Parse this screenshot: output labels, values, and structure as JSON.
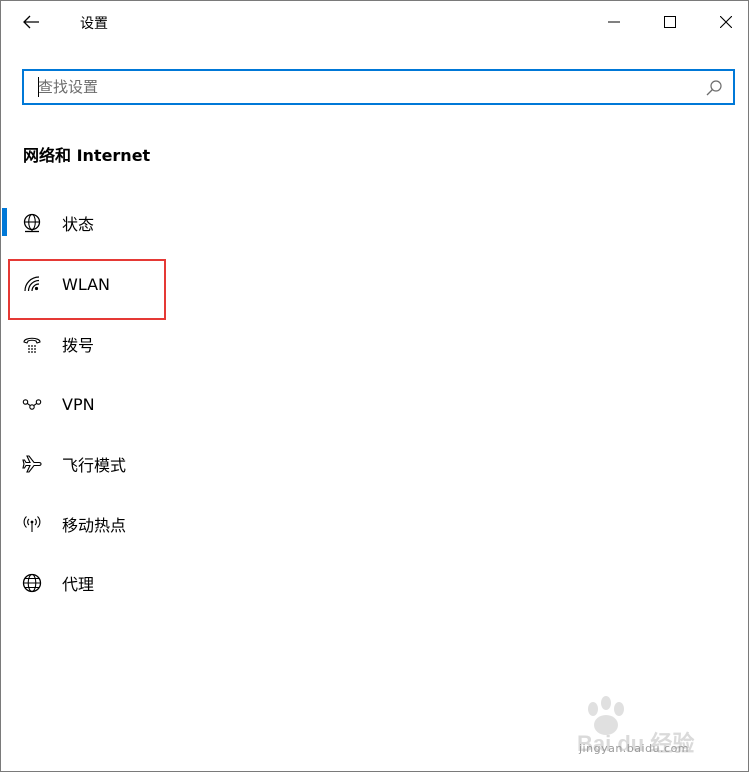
{
  "window": {
    "title": "设置"
  },
  "search": {
    "placeholder": "查找设置",
    "value": ""
  },
  "section": {
    "title": "网络和 Internet"
  },
  "nav": {
    "items": [
      {
        "label": "状态",
        "icon": "globe-status-icon",
        "selected": true
      },
      {
        "label": "WLAN",
        "icon": "wifi-icon",
        "selected": false
      },
      {
        "label": "拨号",
        "icon": "dialup-phone-icon",
        "selected": false
      },
      {
        "label": "VPN",
        "icon": "vpn-icon",
        "selected": false
      },
      {
        "label": "飞行模式",
        "icon": "airplane-icon",
        "selected": false
      },
      {
        "label": "移动热点",
        "icon": "hotspot-icon",
        "selected": false
      },
      {
        "label": "代理",
        "icon": "globe-proxy-icon",
        "selected": false
      }
    ]
  },
  "annotation": {
    "highlight_color": "#e53935"
  },
  "watermark": {
    "brand": "Bai du 经验",
    "url": "jingyan.baidu.com"
  },
  "colors": {
    "accent": "#0078d7",
    "text": "#000000",
    "background": "#ffffff"
  }
}
